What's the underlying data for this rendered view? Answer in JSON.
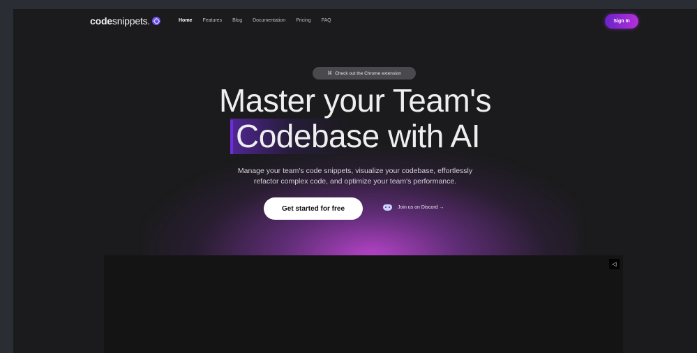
{
  "brand": {
    "name_bold": "code",
    "name_light": "snippets.",
    "logo_icon": "codesnippets-logo-icon"
  },
  "nav": {
    "items": [
      {
        "label": "Home",
        "active": true
      },
      {
        "label": "Features"
      },
      {
        "label": "Blog"
      },
      {
        "label": "Documentation"
      },
      {
        "label": "Pricing"
      },
      {
        "label": "FAQ"
      }
    ],
    "signin_label": "Sign In"
  },
  "hero": {
    "pill_text": "Check out the Chrome extension",
    "pill_icon": "puzzle-icon",
    "headline_line1": "Master your Team's",
    "headline_highlight": "Codebase",
    "headline_rest": " with AI",
    "subtitle_line1": "Manage your team's code snippets, visualize your codebase, effortlessly",
    "subtitle_line2": "refactor complex code, and optimize your team's performance.",
    "cta_label": "Get started for free",
    "discord_label": "Join us on Discord →",
    "discord_icon": "discord-icon"
  },
  "video": {
    "control_icon": "video-control-icon"
  },
  "colors": {
    "accent": "#7b3fe4",
    "glow": "#c048d8",
    "background": "#1b1b1d"
  }
}
